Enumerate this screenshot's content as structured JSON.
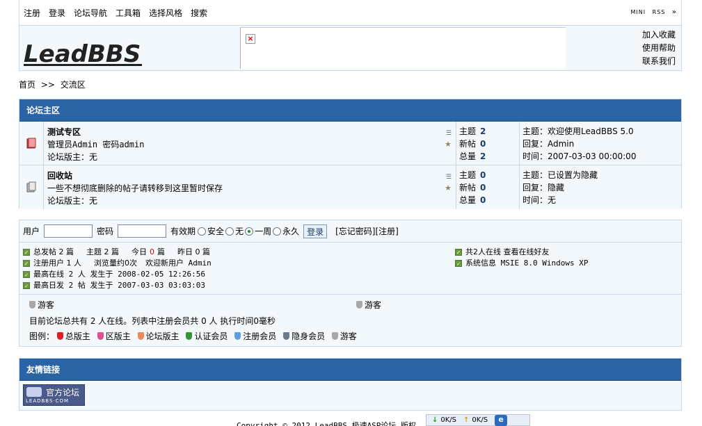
{
  "topnav": {
    "items": [
      "注册",
      "登录",
      "论坛导航",
      "工具箱",
      "选择风格",
      "搜索"
    ],
    "mini": "MINI",
    "rss": "RSS",
    "expand": "»"
  },
  "header": {
    "logo_text": "LeadBBS",
    "banner_broken": "×",
    "links": [
      "加入收藏",
      "使用帮助",
      "联系我们"
    ]
  },
  "breadcrumb": {
    "home": "首页",
    "sep": ">>",
    "current": "交流区"
  },
  "main_section": {
    "title": "论坛主区",
    "forums": [
      {
        "name": "测试专区",
        "desc": "管理员Admin 密码admin",
        "mods": "论坛版主：无",
        "topics_label": "主题",
        "topics": "2",
        "new_label": "新帖",
        "new": "0",
        "total_label": "总量",
        "total": "2",
        "last_topic": "主题：欢迎使用LeadBBS 5.0",
        "last_reply": "回复：Admin",
        "last_time": "时间：2007-03-03 00:00:00"
      },
      {
        "name": "回收站",
        "desc": "一些不想彻底删除的帖子请转移到这里暂时保存",
        "mods": "论坛版主：无",
        "topics_label": "主题",
        "topics": "0",
        "new_label": "新帖",
        "new": "0",
        "total_label": "总量",
        "total": "0",
        "last_topic": "主题：已设置为隐藏",
        "last_reply": "回复：隐藏",
        "last_time": "时间：无"
      }
    ]
  },
  "login": {
    "user_label": "用户",
    "pass_label": "密码",
    "validity_label": "有效期",
    "options": [
      "安全",
      "无",
      "一周",
      "永久"
    ],
    "selected": "一周",
    "button": "登录",
    "forgot": "[忘记密码]",
    "register": "[注册]"
  },
  "stats": {
    "line1": {
      "a": "总发帖 2 篇",
      "b": "主题 2 篇",
      "c": "今日",
      "c_val": "0",
      "c_unit": "篇",
      "d": "昨日 0 篇"
    },
    "line2": {
      "a": "注册用户 1 人",
      "b": "浏览量约0次",
      "c": "欢迎新用户 Admin"
    },
    "line3": "最高在线 2 人 发生于 2008-02-05 12:26:56",
    "line4": "最高日发 2 帖 发生于 2007-03-03 03:03:03",
    "right1": "共2人在线 查看在线好友",
    "right2": "系统信息 MSIE 8.0 Windows XP"
  },
  "online": {
    "guest1": "游客",
    "guest2": "游客",
    "summary": "目前论坛总共有 2 人在线。列表中注册会员共 0 人 执行时间0毫秒",
    "legend_label": "图例：",
    "legend": [
      {
        "label": "总版主",
        "color": "#e02020"
      },
      {
        "label": "区版主",
        "color": "#e05090"
      },
      {
        "label": "论坛版主",
        "color": "#f08a50"
      },
      {
        "label": "认证会员",
        "color": "#2a9a2a"
      },
      {
        "label": "注册会员",
        "color": "#5aa0e0"
      },
      {
        "label": "隐身会员",
        "color": "#6a7a90"
      },
      {
        "label": "游客",
        "color": "#a8a8a8"
      }
    ]
  },
  "links_section": {
    "title": "友情链接",
    "official_cn": "官方论坛",
    "official_en": "LEADBBS·COM"
  },
  "footer": {
    "text": "Copyright © 2012 LeadBBS 极速ASP论坛 版权"
  },
  "speed": {
    "down": "0K/S",
    "up": "0K/S"
  },
  "colors": {
    "title_bar": "#2a64a4",
    "panel_bg": "#f3f8fc",
    "border": "#c8d8e8",
    "accent_num": "#1a3d6e"
  }
}
